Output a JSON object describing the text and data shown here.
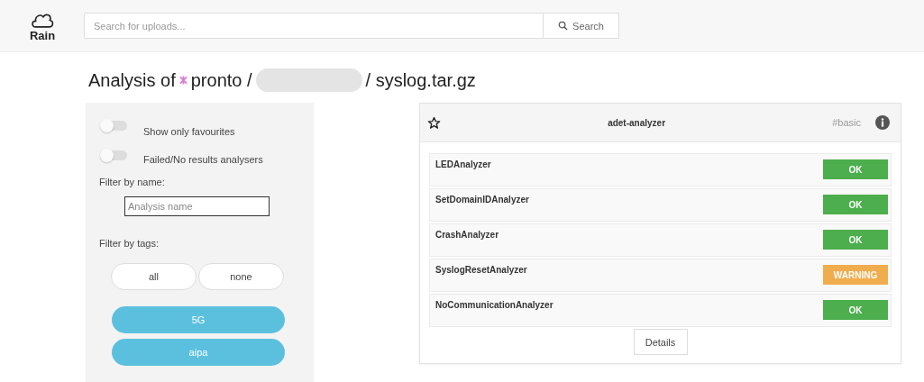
{
  "header": {
    "logo": "Rain",
    "search": {
      "placeholder": "Search for uploads..."
    },
    "search_button": "Search"
  },
  "title": {
    "prefix": "Analysis of",
    "project": "pronto /",
    "file": "/ syslog.tar.gz"
  },
  "filters": {
    "toggles": [
      {
        "label": "Show only favourites",
        "on": false
      },
      {
        "label": "Failed/No results analysers",
        "on": false
      }
    ],
    "name_label": "Filter by name:",
    "name_field": {
      "placeholder": "Analysis name"
    },
    "tags_label": "Filter by tags:",
    "tag_controls": [
      "all",
      "none"
    ],
    "tags": [
      {
        "label": "5G",
        "selected": true
      },
      {
        "label": "aipa",
        "selected": true
      }
    ]
  },
  "analyzer": {
    "favourite": false,
    "title": "adet-analyzer",
    "tag": "#basic",
    "results": [
      {
        "name": "LEDAnalyzer",
        "status": "OK",
        "kind": "ok"
      },
      {
        "name": "SetDomainIDAnalyzer",
        "status": "OK",
        "kind": "ok"
      },
      {
        "name": "CrashAnalyzer",
        "status": "OK",
        "kind": "ok"
      },
      {
        "name": "SyslogResetAnalyzer",
        "status": "WARNING",
        "kind": "warning"
      },
      {
        "name": "NoCommunicationAnalyzer",
        "status": "OK",
        "kind": "ok"
      }
    ],
    "details_button": "Details"
  }
}
